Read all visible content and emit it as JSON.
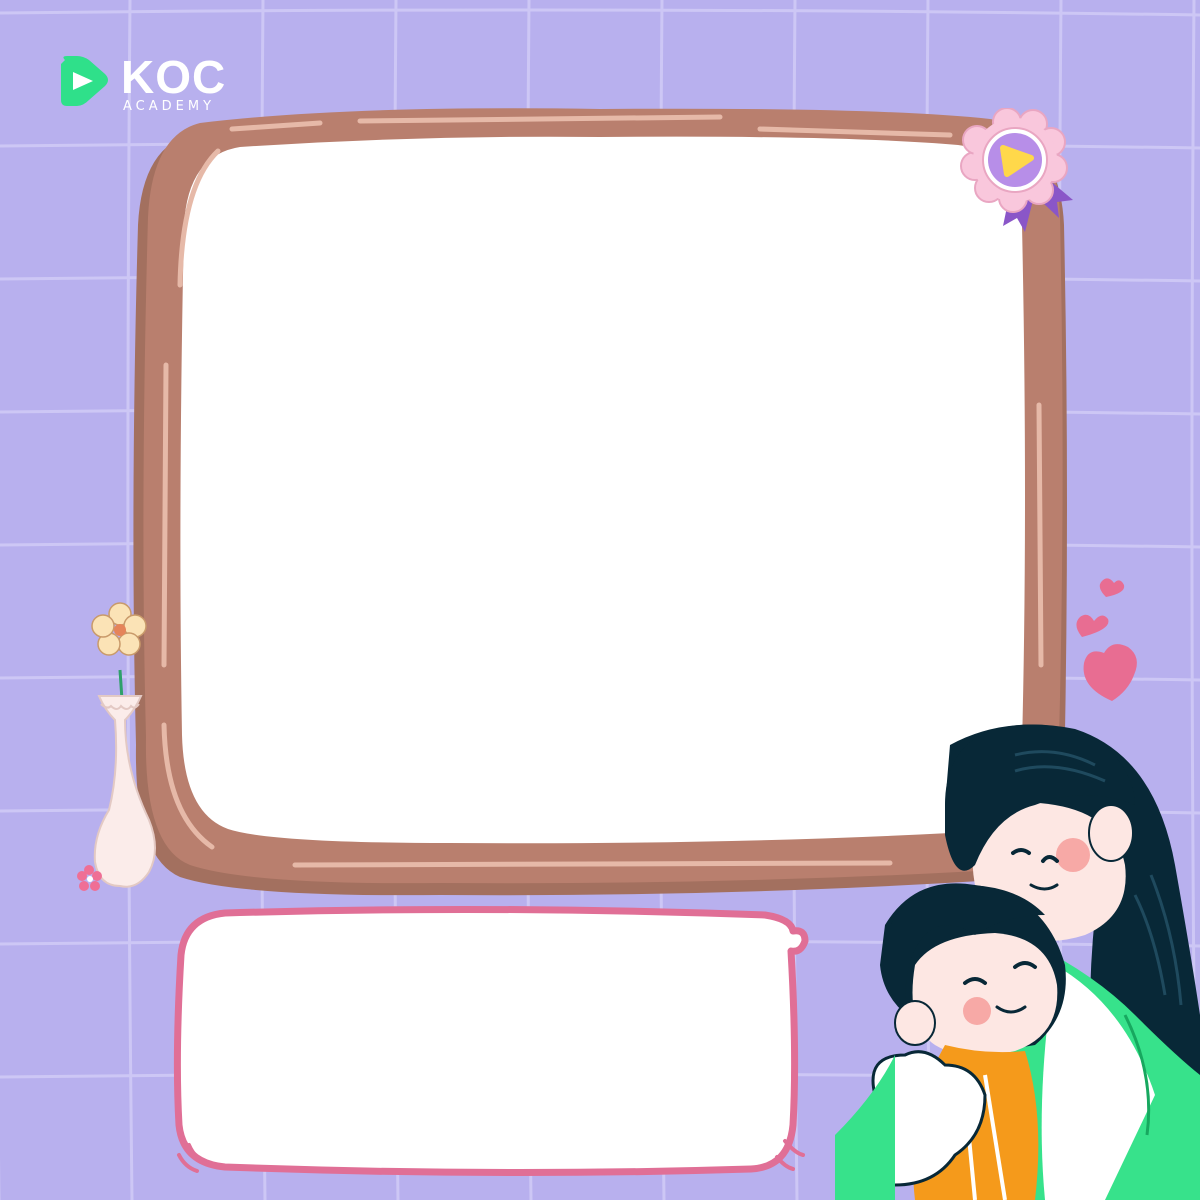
{
  "brand": {
    "name": "KOC",
    "subtitle": "ACADEMY"
  },
  "colors": {
    "background": "#b8b0ee",
    "grid": "#cdc7f5",
    "frame": "#b97f6e",
    "frame_shadow": "#a3705f",
    "frame_highlight": "#e6b9a8",
    "panel": "#ffffff",
    "bubble_border": "#e06f96",
    "logo_green": "#2fe08a",
    "logo_text": "#ffffff",
    "heart": "#e86d92",
    "hair": "#082837",
    "skin": "#fde7e3",
    "cheek": "#f7a9a6",
    "jacket": "#37e28b",
    "dress": "#f59a1b",
    "badge": "#f9c7dc",
    "badge_center": "#b78ee8",
    "ribbon": "#8a56c8",
    "vase": "#fbecea",
    "flower": "#fbe3b6"
  },
  "icons": {
    "logo": "play-icon",
    "badge": "rosette-badge-icon",
    "hearts": "heart-icon"
  }
}
